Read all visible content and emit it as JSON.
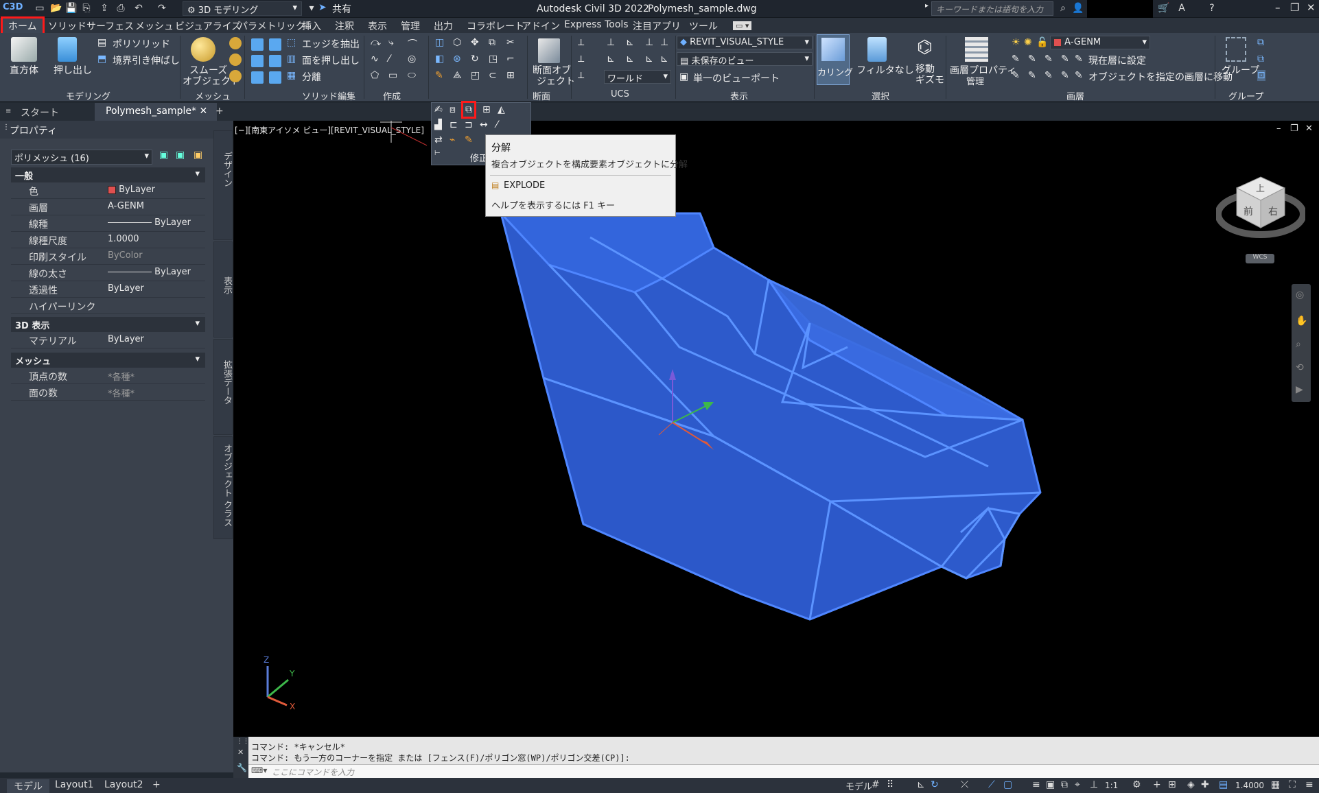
{
  "app": {
    "title": "Autodesk Civil 3D 2022",
    "file": "Polymesh_sample.dwg",
    "logo": "C3D",
    "share": "共有",
    "workspace": "3D モデリング",
    "search_placeholder": "キーワードまたは語句を入力"
  },
  "ribbon_tabs": [
    "ホーム",
    "ソリッド",
    "サーフェス",
    "メッシュ",
    "ビジュアライズ",
    "パラメトリック",
    "挿入",
    "注釈",
    "表示",
    "管理",
    "出力",
    "コラボレート",
    "アドイン",
    "Express Tools",
    "注目アプリ",
    "ツール"
  ],
  "ribbon": {
    "modeling": {
      "title": "モデリング",
      "box": "直方体",
      "extrude": "押し出し",
      "polysolid": "ポリソリッド",
      "presspull": "境界引き伸ばし"
    },
    "mesh": {
      "title": "メッシュ",
      "smooth": "スムーズ",
      "smooth2": "オブジェクト"
    },
    "solid_edit": {
      "title": "ソリッド編集",
      "extract_edges": "エッジを抽出",
      "extrude_faces": "面を押し出し",
      "separate": "分離"
    },
    "draw": {
      "title": "作成"
    },
    "modify": {
      "title": "修正"
    },
    "section": {
      "title": "断面",
      "plane": "断面オブ",
      "plane2": "ジェクト"
    },
    "ucs": {
      "title": "UCS",
      "world": "ワールド"
    },
    "view": {
      "title": "表示",
      "visual_style": "REVIT_VISUAL_STYLE",
      "unsaved_view": "未保存のビュー",
      "single_viewport": "単一のビューポート"
    },
    "selection": {
      "title": "選択",
      "culling": "カリング",
      "no_filter": "フィルタなし",
      "move": "移動",
      "gizmo": "ギズモ"
    },
    "layers": {
      "title": "画層",
      "layer_props": "画層プロパティ",
      "manage": "管理",
      "current_layer": "A-GENM",
      "set_current": "現在層に設定",
      "move_to_layer": "オブジェクトを指定の画層に移動"
    },
    "groups": {
      "title": "グループ",
      "group": "グループ"
    }
  },
  "doc_tabs": {
    "start": "スタート",
    "active": "Polymesh_sample*"
  },
  "properties": {
    "title": "プロパティ",
    "selection": "ポリメッシュ (16)",
    "general": "一般",
    "rows": [
      {
        "k": "色",
        "v": "ByLayer"
      },
      {
        "k": "画層",
        "v": "A-GENM"
      },
      {
        "k": "線種",
        "v": "ByLayer"
      },
      {
        "k": "線種尺度",
        "v": "1.0000"
      },
      {
        "k": "印刷スタイル",
        "v": "ByColor"
      },
      {
        "k": "線の太さ",
        "v": "ByLayer"
      },
      {
        "k": "透過性",
        "v": "ByLayer"
      },
      {
        "k": "ハイパーリンク",
        "v": ""
      }
    ],
    "view3d": "3D 表示",
    "material_k": "マテリアル",
    "material_v": "ByLayer",
    "mesh": "メッシュ",
    "vertices_k": "頂点の数",
    "vertices_v": "*各種*",
    "faces_k": "面の数",
    "faces_v": "*各種*",
    "side_tabs": [
      "デザイン",
      "表示",
      "拡張データ",
      "オブジェクト クラス"
    ]
  },
  "viewport": {
    "label": "[−][南東アイソメ ビュー][REVIT_VISUAL_STYLE]",
    "cube_top": "上",
    "cube_front": "前",
    "cube_right": "右",
    "wcs": "WCS"
  },
  "tooltip": {
    "title": "分解",
    "desc": "複合オブジェクトを構成要素オブジェクトに分解",
    "command": "EXPLODE",
    "help": "ヘルプを表示するには F1 キー"
  },
  "command": {
    "line1": "コマンド: *キャンセル*",
    "line2": "コマンド: もう一方のコーナーを指定 または [フェンス(F)/ポリゴン窓(WP)/ポリゴン交差(CP)]:",
    "input_placeholder": "ここにコマンドを入力"
  },
  "status": {
    "tabs": [
      "モデル",
      "Layout1",
      "Layout2"
    ],
    "model": "モデル",
    "scale": "1:1",
    "zoom": "1.4000"
  }
}
